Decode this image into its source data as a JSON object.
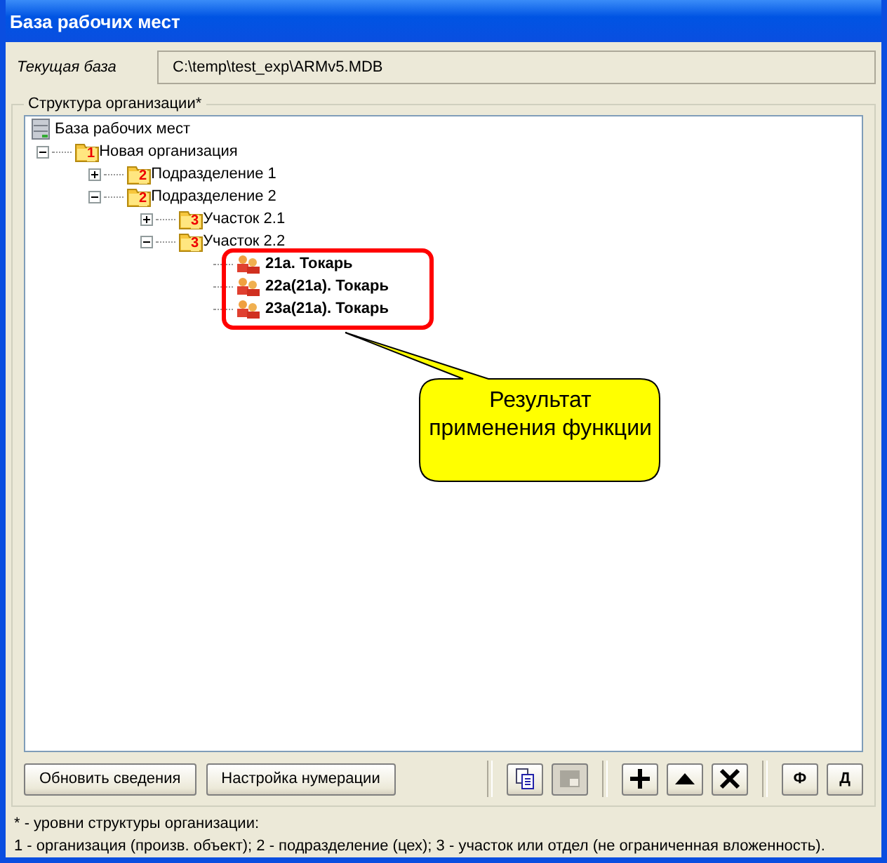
{
  "window": {
    "title": "База рабочих мест"
  },
  "current_db": {
    "label": "Текущая база",
    "value": "C:\\temp\\test_exp\\ARMv5.MDB"
  },
  "structure": {
    "title": "Структура организации*",
    "tree": [
      {
        "kind": "database",
        "label": "База рабочих мест",
        "children": [
          {
            "kind": "folder",
            "badge": "1",
            "label": "Новая организация",
            "expanded": true,
            "children": [
              {
                "kind": "folder",
                "badge": "2",
                "label": "Подразделение 1",
                "expanded": false
              },
              {
                "kind": "folder",
                "badge": "2",
                "label": "Подразделение 2",
                "expanded": true,
                "children": [
                  {
                    "kind": "folder",
                    "badge": "3",
                    "label": "Участок 2.1",
                    "expanded": false
                  },
                  {
                    "kind": "folder",
                    "badge": "3",
                    "label": "Участок 2.2",
                    "expanded": true,
                    "children": [
                      {
                        "kind": "workplace",
                        "label": "21а. Токарь"
                      },
                      {
                        "kind": "workplace",
                        "label": "22а(21а). Токарь"
                      },
                      {
                        "kind": "workplace",
                        "label": "23а(21а). Токарь"
                      }
                    ]
                  }
                ]
              }
            ]
          }
        ]
      }
    ]
  },
  "callout": {
    "text": "Результат применения функции"
  },
  "button_groups": [
    {
      "buttons": [
        {
          "kind": "text",
          "label": "Обновить сведения"
        },
        {
          "kind": "text",
          "label": "Настройка нумерации"
        }
      ]
    },
    {
      "buttons": [
        {
          "kind": "copy",
          "disabled": false
        },
        {
          "kind": "paste",
          "disabled": true
        }
      ]
    },
    {
      "buttons": [
        {
          "kind": "add",
          "disabled": false
        },
        {
          "kind": "up",
          "disabled": false
        },
        {
          "kind": "delete",
          "disabled": false
        }
      ]
    },
    {
      "buttons": [
        {
          "kind": "letter",
          "label": "Ф"
        },
        {
          "kind": "letter",
          "label": "Д"
        }
      ]
    }
  ],
  "notes": [
    "* - уровни структуры организации:",
    "1 - организация (произв. объект); 2 - подразделение (цех); 3 - участок или отдел (не ограниченная вложенность)."
  ]
}
